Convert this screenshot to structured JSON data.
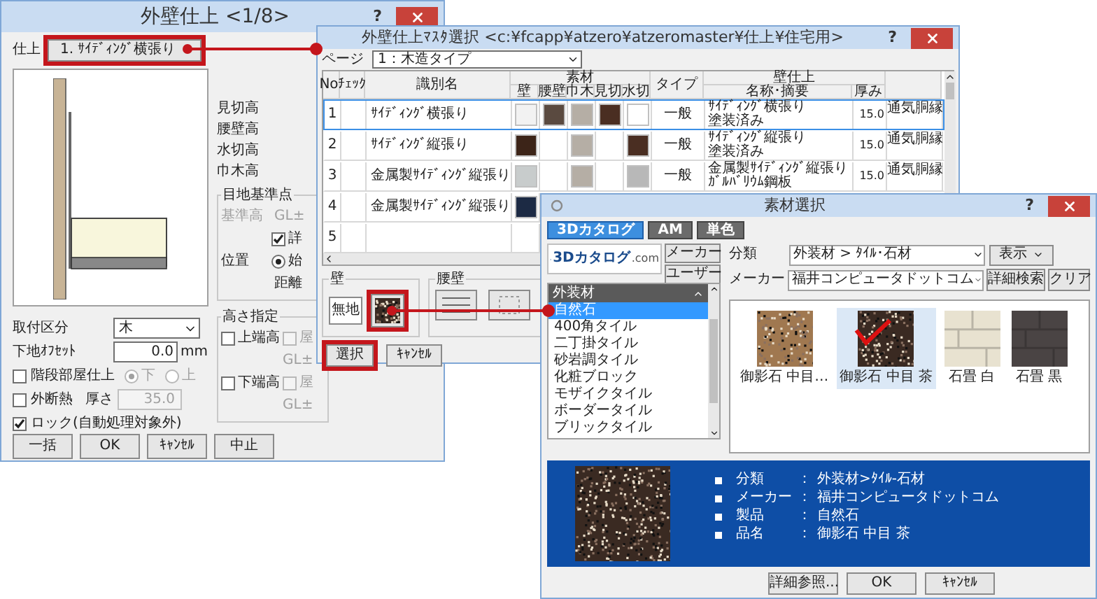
{
  "finish_dialog": {
    "title": "外壁仕上 <1/8>",
    "help": "?",
    "finish_label": "仕上",
    "finish_button": "1. ｻｲﾃﾞｨﾝｸﾞ横張り",
    "height_labels": [
      "見切高",
      "腰壁高",
      "水切高",
      "巾木高"
    ],
    "joint_group": {
      "title": "目地基準点",
      "base_label": "基準高",
      "base_unit": "GL±",
      "base_disabled": true,
      "detail": {
        "label": "詳",
        "checked": true
      },
      "position_label": "位置",
      "start": {
        "label": "始",
        "selected": true
      },
      "distance_label": "距離"
    },
    "height_group": {
      "title": "高さ指定",
      "rows": [
        {
          "label": "上端高",
          "checked": false,
          "roof_label": "屋",
          "roof_checked": false,
          "roof_disabled": true,
          "unit": "GL±"
        },
        {
          "label": "下端高",
          "checked": false,
          "roof_label": "屋",
          "roof_checked": false,
          "roof_disabled": true,
          "unit": "GL±"
        }
      ]
    },
    "mount": {
      "label": "取付区分",
      "value": "木"
    },
    "offset": {
      "label": "下地ｵﾌｾｯﾄ",
      "value": "0.0",
      "unit": "mm"
    },
    "stair": {
      "label": "階段部屋仕上",
      "checked": false,
      "disabled": true,
      "options": [
        {
          "label": "下",
          "selected": true
        },
        {
          "label": "上",
          "selected": false
        }
      ]
    },
    "insulation": {
      "label": "外断熱",
      "checked": false,
      "thickness_label": "厚さ",
      "thickness": "35.0",
      "disabled": true
    },
    "lock": {
      "label": "ロック(自動処理対象外)",
      "checked": true
    },
    "buttons": [
      "一括",
      "OK",
      "ｷｬﾝｾﾙ",
      "中止"
    ]
  },
  "master_dialog": {
    "title": "外壁仕上ﾏｽﾀ選択 <c:¥fcapp¥atzero¥atzeromaster¥仕上¥住宅用>",
    "help": "?",
    "page_label": "ページ",
    "page_value": "1：木造タイプ",
    "table": {
      "columns": [
        "No.",
        "ﾁｪｯｸ",
        "識別名",
        "素材",
        "タイプ",
        "壁仕上"
      ],
      "material_columns": [
        "壁",
        "腰壁",
        "巾木",
        "見切",
        "水切"
      ],
      "finish_columns": [
        "名称･摘要",
        "厚み"
      ],
      "rows": [
        {
          "no": "1",
          "name": "ｻｲﾃﾞｨﾝｸﾞ横張り",
          "selected": true,
          "swatches": {
            "wall": {
              "color": "#f2f2f2"
            },
            "waist": {
              "color": "#5a4a40"
            },
            "baseboard": {
              "color": "#b5aea5"
            },
            "trim": {
              "color": "#4a2e22"
            },
            "drip": {
              "color": "#ffffff"
            }
          },
          "type": "一般",
          "finish_name": "ｻｲﾃﾞｨﾝｸﾞ横張り",
          "finish_note": "塗装済み",
          "thickness": "15.0",
          "extra": "通気胴縁"
        },
        {
          "no": "2",
          "name": "ｻｲﾃﾞｨﾝｸﾞ縦張り",
          "selected": false,
          "swatches": {
            "wall": {
              "color": "#3c2418"
            },
            "baseboard": {
              "color": "#b5aea5"
            },
            "drip": {
              "color": "#4a2e22"
            }
          },
          "type": "一般",
          "finish_name": "ｻｲﾃﾞｨﾝｸﾞ縦張り",
          "finish_note": "塗装済み",
          "thickness": "15.0",
          "extra": "通気胴縁"
        },
        {
          "no": "3",
          "name": "金属製ｻｲﾃﾞｨﾝｸﾞ縦張り",
          "selected": false,
          "swatches": {
            "wall": {
              "color": "#c8cccc"
            },
            "baseboard": {
              "color": "#b5aea5"
            },
            "drip": {
              "color": "#b8b8b8"
            }
          },
          "type": "一般",
          "finish_name": "金属製ｻｲﾃﾞｨﾝｸﾞ縦張り",
          "finish_note": "ｶﾞﾙﾊﾞﾘｳﾑ鋼板",
          "thickness": "15.0",
          "extra": "通気胴縁"
        },
        {
          "no": "4",
          "name": "金属製ｻｲﾃﾞｨﾝｸﾞ縦張り",
          "selected": false,
          "swatches": {
            "wall": {
              "color": "#1c2a44"
            }
          }
        },
        {
          "no": "5",
          "selected": false
        }
      ]
    },
    "wall_group": {
      "title": "壁",
      "plain_button": "無地"
    },
    "waist_group": {
      "title": "腰壁"
    },
    "buttons": [
      "選択",
      "ｷｬﾝｾﾙ"
    ]
  },
  "material_dialog": {
    "title": "素材選択",
    "help": "?",
    "tabs": [
      {
        "label": "3Dカタログ",
        "selected": true
      },
      {
        "label": "AM",
        "selected": false
      },
      {
        "label": "単色",
        "selected": false
      }
    ],
    "logo": {
      "text": "3Dカタログ",
      "suffix": ".com"
    },
    "source_buttons": [
      "メーカー",
      "ユーザー"
    ],
    "category": {
      "label": "分類",
      "value": "外装材 > ﾀｲﾙ･石材"
    },
    "display_button": "表示",
    "maker": {
      "label": "メーカー",
      "value": "福井コンピュータドットコム"
    },
    "search_button": "詳細検索",
    "clear_button": "クリア",
    "list": {
      "header": "外装材",
      "items": [
        {
          "label": "自然石",
          "selected": true
        },
        {
          "label": "400角タイル",
          "selected": false
        },
        {
          "label": "二丁掛タイル",
          "selected": false
        },
        {
          "label": "砂岩調タイル",
          "selected": false
        },
        {
          "label": "化粧ブロック",
          "selected": false
        },
        {
          "label": "モザイクタイル",
          "selected": false
        },
        {
          "label": "ボーダータイル",
          "selected": false
        },
        {
          "label": "ブリックタイル",
          "selected": false
        }
      ]
    },
    "thumbnails": [
      {
        "label": "御影石 中目…",
        "kind": "granite",
        "color": "#a07850",
        "selected": false
      },
      {
        "label": "御影石 中目 茶",
        "kind": "granite",
        "color": "#3a2a22",
        "selected": true
      },
      {
        "label": "石畳 白",
        "kind": "tile",
        "color": "#e8e2d0",
        "selected": false
      },
      {
        "label": "石畳 黒",
        "kind": "tile",
        "color": "#4a4444",
        "selected": false
      }
    ],
    "info": [
      {
        "label": "分類",
        "sep": "：",
        "value": "外装材>ﾀｲﾙ-石材"
      },
      {
        "label": "メーカー",
        "sep": "：",
        "value": "福井コンピュータドットコム"
      },
      {
        "label": "製品",
        "sep": "：",
        "value": "自然石"
      },
      {
        "label": "品名",
        "sep": "：",
        "value": "御影石 中目 茶"
      }
    ],
    "buttons": [
      "詳細参照...",
      "OK",
      "ｷｬﾝｾﾙ"
    ]
  }
}
